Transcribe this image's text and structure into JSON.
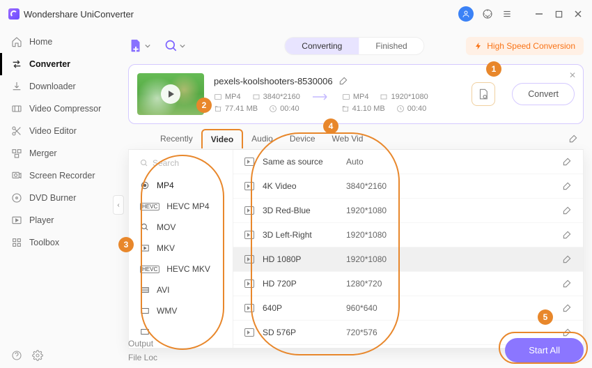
{
  "app": {
    "title": "Wondershare UniConverter"
  },
  "header": {
    "tabs": {
      "converting": "Converting",
      "finished": "Finished"
    },
    "high_speed": "High Speed Conversion"
  },
  "sidebar": {
    "items": [
      {
        "label": "Home"
      },
      {
        "label": "Converter"
      },
      {
        "label": "Downloader"
      },
      {
        "label": "Video Compressor"
      },
      {
        "label": "Video Editor"
      },
      {
        "label": "Merger"
      },
      {
        "label": "Screen Recorder"
      },
      {
        "label": "DVD Burner"
      },
      {
        "label": "Player"
      },
      {
        "label": "Toolbox"
      }
    ]
  },
  "file": {
    "name": "pexels-koolshooters-8530006",
    "src": {
      "container": "MP4",
      "resolution": "3840*2160",
      "size": "77.41 MB",
      "duration": "00:40"
    },
    "dst": {
      "container": "MP4",
      "resolution": "1920*1080",
      "size": "41.10 MB",
      "duration": "00:40"
    },
    "convert_label": "Convert"
  },
  "subtabs": {
    "recently": "Recently",
    "video": "Video",
    "audio": "Audio",
    "device": "Device",
    "webvideo": "Web Vid"
  },
  "search_placeholder": "Search",
  "formats": [
    {
      "label": "MP4"
    },
    {
      "label": "HEVC MP4"
    },
    {
      "label": "MOV"
    },
    {
      "label": "MKV"
    },
    {
      "label": "HEVC MKV"
    },
    {
      "label": "AVI"
    },
    {
      "label": "WMV"
    }
  ],
  "presets": [
    {
      "name": "Same as source",
      "res": "Auto"
    },
    {
      "name": "4K Video",
      "res": "3840*2160"
    },
    {
      "name": "3D Red-Blue",
      "res": "1920*1080"
    },
    {
      "name": "3D Left-Right",
      "res": "1920*1080"
    },
    {
      "name": "HD 1080P",
      "res": "1920*1080"
    },
    {
      "name": "HD 720P",
      "res": "1280*720"
    },
    {
      "name": "640P",
      "res": "960*640"
    },
    {
      "name": "SD 576P",
      "res": "720*576"
    }
  ],
  "bottom": {
    "output": "Output",
    "fileloc": "File Loc",
    "start_all": "Start All"
  },
  "callouts": {
    "c1": "1",
    "c2": "2",
    "c3": "3",
    "c4": "4",
    "c5": "5"
  }
}
